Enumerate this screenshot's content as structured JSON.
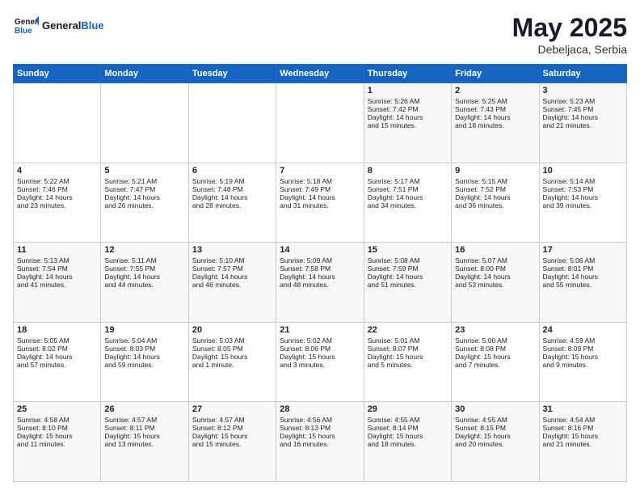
{
  "header": {
    "logo_general": "General",
    "logo_blue": "Blue",
    "month": "May 2025",
    "location": "Debeljaca, Serbia"
  },
  "days_of_week": [
    "Sunday",
    "Monday",
    "Tuesday",
    "Wednesday",
    "Thursday",
    "Friday",
    "Saturday"
  ],
  "weeks": [
    [
      {
        "day": "",
        "content": ""
      },
      {
        "day": "",
        "content": ""
      },
      {
        "day": "",
        "content": ""
      },
      {
        "day": "",
        "content": ""
      },
      {
        "day": "1",
        "content": "Sunrise: 5:26 AM\nSunset: 7:42 PM\nDaylight: 14 hours\nand 15 minutes."
      },
      {
        "day": "2",
        "content": "Sunrise: 5:25 AM\nSunset: 7:43 PM\nDaylight: 14 hours\nand 18 minutes."
      },
      {
        "day": "3",
        "content": "Sunrise: 5:23 AM\nSunset: 7:45 PM\nDaylight: 14 hours\nand 21 minutes."
      }
    ],
    [
      {
        "day": "4",
        "content": "Sunrise: 5:22 AM\nSunset: 7:46 PM\nDaylight: 14 hours\nand 23 minutes."
      },
      {
        "day": "5",
        "content": "Sunrise: 5:21 AM\nSunset: 7:47 PM\nDaylight: 14 hours\nand 26 minutes."
      },
      {
        "day": "6",
        "content": "Sunrise: 5:19 AM\nSunset: 7:48 PM\nDaylight: 14 hours\nand 28 minutes."
      },
      {
        "day": "7",
        "content": "Sunrise: 5:18 AM\nSunset: 7:49 PM\nDaylight: 14 hours\nand 31 minutes."
      },
      {
        "day": "8",
        "content": "Sunrise: 5:17 AM\nSunset: 7:51 PM\nDaylight: 14 hours\nand 34 minutes."
      },
      {
        "day": "9",
        "content": "Sunrise: 5:15 AM\nSunset: 7:52 PM\nDaylight: 14 hours\nand 36 minutes."
      },
      {
        "day": "10",
        "content": "Sunrise: 5:14 AM\nSunset: 7:53 PM\nDaylight: 14 hours\nand 39 minutes."
      }
    ],
    [
      {
        "day": "11",
        "content": "Sunrise: 5:13 AM\nSunset: 7:54 PM\nDaylight: 14 hours\nand 41 minutes."
      },
      {
        "day": "12",
        "content": "Sunrise: 5:11 AM\nSunset: 7:55 PM\nDaylight: 14 hours\nand 44 minutes."
      },
      {
        "day": "13",
        "content": "Sunrise: 5:10 AM\nSunset: 7:57 PM\nDaylight: 14 hours\nand 46 minutes."
      },
      {
        "day": "14",
        "content": "Sunrise: 5:09 AM\nSunset: 7:58 PM\nDaylight: 14 hours\nand 48 minutes."
      },
      {
        "day": "15",
        "content": "Sunrise: 5:08 AM\nSunset: 7:59 PM\nDaylight: 14 hours\nand 51 minutes."
      },
      {
        "day": "16",
        "content": "Sunrise: 5:07 AM\nSunset: 8:00 PM\nDaylight: 14 hours\nand 53 minutes."
      },
      {
        "day": "17",
        "content": "Sunrise: 5:06 AM\nSunset: 8:01 PM\nDaylight: 14 hours\nand 55 minutes."
      }
    ],
    [
      {
        "day": "18",
        "content": "Sunrise: 5:05 AM\nSunset: 8:02 PM\nDaylight: 14 hours\nand 57 minutes."
      },
      {
        "day": "19",
        "content": "Sunrise: 5:04 AM\nSunset: 8:03 PM\nDaylight: 14 hours\nand 59 minutes."
      },
      {
        "day": "20",
        "content": "Sunrise: 5:03 AM\nSunset: 8:05 PM\nDaylight: 15 hours\nand 1 minute."
      },
      {
        "day": "21",
        "content": "Sunrise: 5:02 AM\nSunset: 8:06 PM\nDaylight: 15 hours\nand 3 minutes."
      },
      {
        "day": "22",
        "content": "Sunrise: 5:01 AM\nSunset: 8:07 PM\nDaylight: 15 hours\nand 5 minutes."
      },
      {
        "day": "23",
        "content": "Sunrise: 5:00 AM\nSunset: 8:08 PM\nDaylight: 15 hours\nand 7 minutes."
      },
      {
        "day": "24",
        "content": "Sunrise: 4:59 AM\nSunset: 8:09 PM\nDaylight: 15 hours\nand 9 minutes."
      }
    ],
    [
      {
        "day": "25",
        "content": "Sunrise: 4:58 AM\nSunset: 8:10 PM\nDaylight: 15 hours\nand 11 minutes."
      },
      {
        "day": "26",
        "content": "Sunrise: 4:57 AM\nSunset: 8:11 PM\nDaylight: 15 hours\nand 13 minutes."
      },
      {
        "day": "27",
        "content": "Sunrise: 4:57 AM\nSunset: 8:12 PM\nDaylight: 15 hours\nand 15 minutes."
      },
      {
        "day": "28",
        "content": "Sunrise: 4:56 AM\nSunset: 8:13 PM\nDaylight: 15 hours\nand 16 minutes."
      },
      {
        "day": "29",
        "content": "Sunrise: 4:55 AM\nSunset: 8:14 PM\nDaylight: 15 hours\nand 18 minutes."
      },
      {
        "day": "30",
        "content": "Sunrise: 4:55 AM\nSunset: 8:15 PM\nDaylight: 15 hours\nand 20 minutes."
      },
      {
        "day": "31",
        "content": "Sunrise: 4:54 AM\nSunset: 8:16 PM\nDaylight: 15 hours\nand 21 minutes."
      }
    ]
  ]
}
